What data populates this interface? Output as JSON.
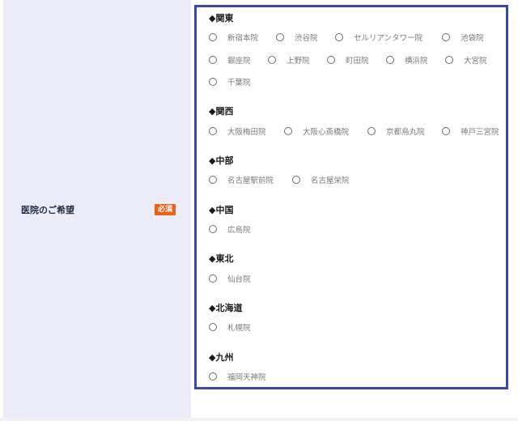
{
  "field": {
    "label": "医院のご希望",
    "required_badge": "必須"
  },
  "regions": [
    {
      "heading": "◆関東",
      "options": [
        "新宿本院",
        "渋谷院",
        "セルリアンタワー院",
        "池袋院",
        "銀座院",
        "上野院",
        "町田院",
        "横浜院",
        "大宮院",
        "千葉院"
      ]
    },
    {
      "heading": "◆関西",
      "options": [
        "大阪梅田院",
        "大阪心斎橋院",
        "京都烏丸院",
        "神戸三宮院"
      ]
    },
    {
      "heading": "◆中部",
      "options": [
        "名古屋駅前院",
        "名古屋栄院"
      ]
    },
    {
      "heading": "◆中国",
      "options": [
        "広島院"
      ]
    },
    {
      "heading": "◆東北",
      "options": [
        "仙台院"
      ]
    },
    {
      "heading": "◆北海道",
      "options": [
        "札幌院"
      ]
    },
    {
      "heading": "◆九州",
      "options": [
        "福岡天神院"
      ]
    }
  ],
  "colors": {
    "label_background": "#ececf8",
    "box_border": "#3a46a8",
    "badge": "#e8621a"
  }
}
